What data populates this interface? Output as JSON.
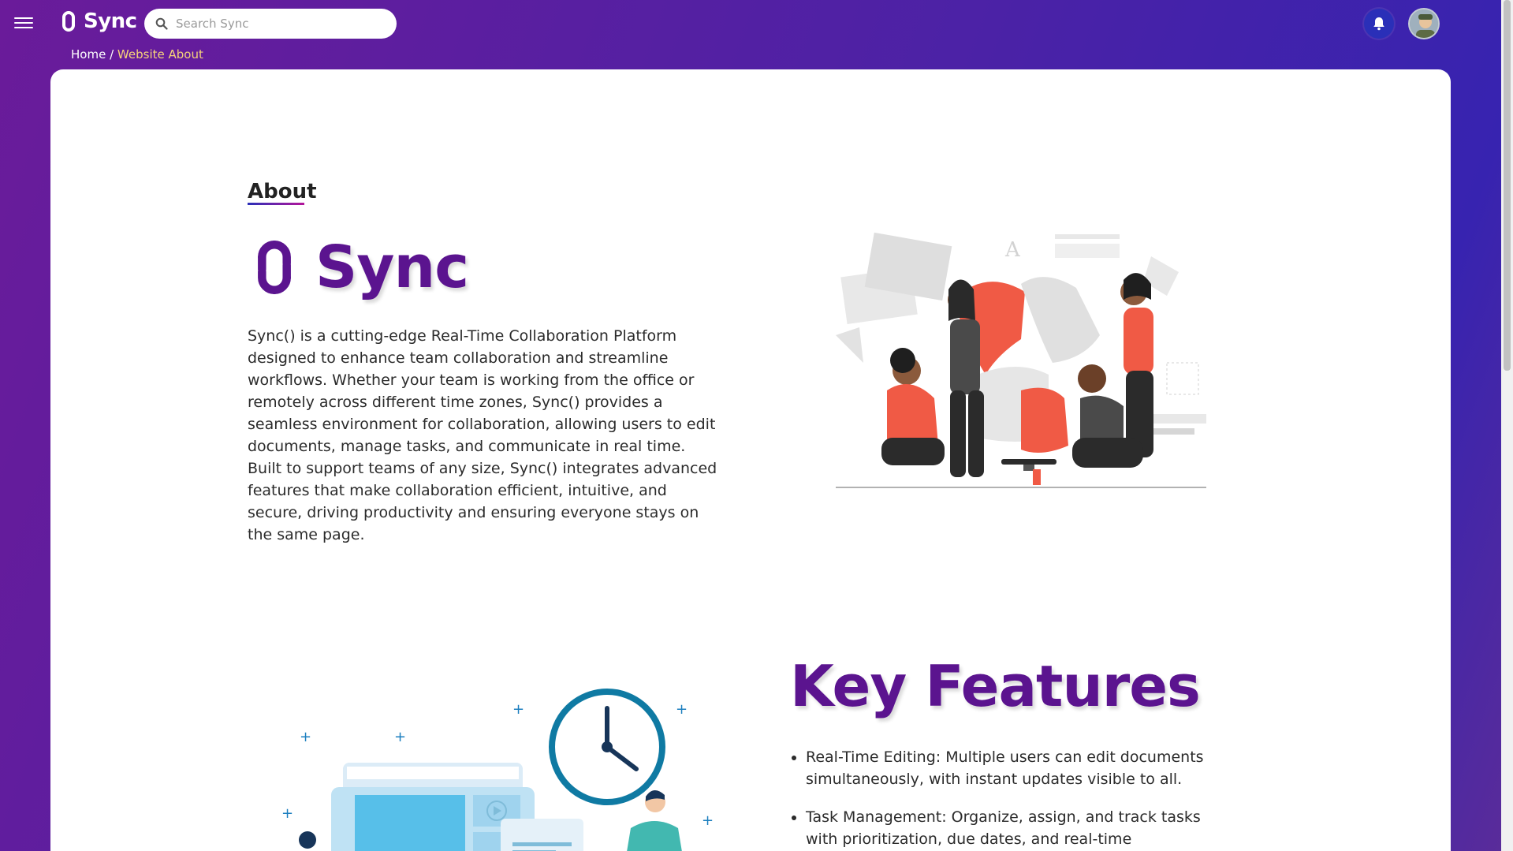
{
  "app": {
    "name": "Sync",
    "search_placeholder": "Search Sync"
  },
  "breadcrumb": {
    "home": "Home",
    "separator": "/",
    "current": "Website About"
  },
  "about": {
    "label": "About",
    "brand": "Sync",
    "description": "Sync() is a cutting-edge Real-Time Collaboration Platform designed to enhance team collaboration and streamline workflows. Whether your team is working from the office or remotely across different time zones, Sync() provides a seamless environment for collaboration, allowing users to edit documents, manage tasks, and communicate in real time. Built to support teams of any size, Sync() integrates advanced features that make collaboration efficient, intuitive, and secure, driving productivity and ensuring everyone stays on the same page."
  },
  "key_features": {
    "title": "Key Features",
    "items": [
      "Real-Time Editing: Multiple users can edit documents simultaneously, with instant updates visible to all.",
      "Task Management: Organize, assign, and track tasks with prioritization, due dates, and real-time notifications."
    ]
  },
  "colors": {
    "brand_purple": "#5b148f",
    "breadcrumb_current": "#f7d47a",
    "accent_red": "#f05a45"
  },
  "icons": [
    "menu-icon",
    "sync-logo-icon",
    "search-icon",
    "bell-icon",
    "avatar"
  ]
}
